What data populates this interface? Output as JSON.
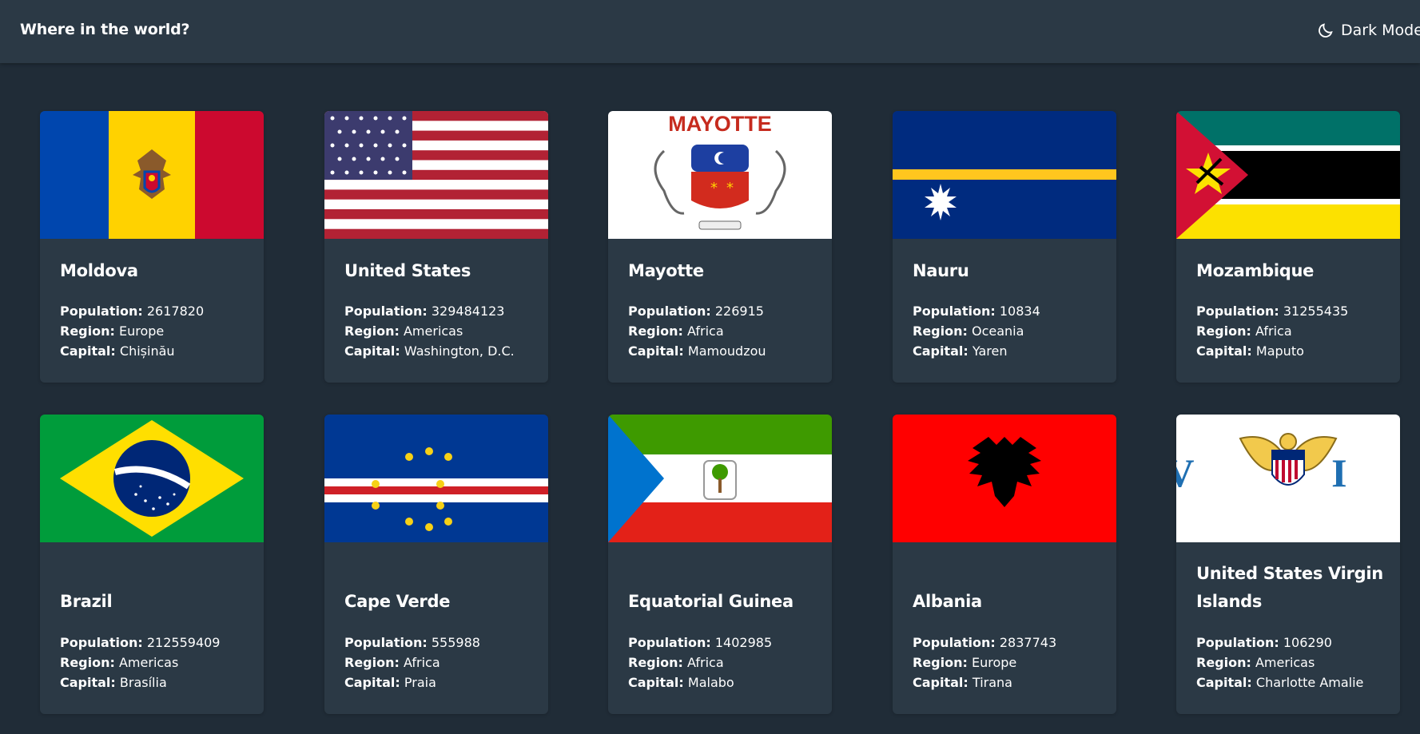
{
  "header": {
    "title": "Where in the world?",
    "mode_label": "Dark Mode",
    "mode_icon": "moon-icon"
  },
  "labels": {
    "population": "Population:",
    "region": "Region:",
    "capital": "Capital:"
  },
  "countries": [
    {
      "name": "Moldova",
      "population": "2617820",
      "region": "Europe",
      "capital": "Chișinău",
      "flag": "moldova-flag"
    },
    {
      "name": "United States",
      "population": "329484123",
      "region": "Americas",
      "capital": "Washington, D.C.",
      "flag": "united-states-flag"
    },
    {
      "name": "Mayotte",
      "population": "226915",
      "region": "Africa",
      "capital": "Mamoudzou",
      "flag": "mayotte-flag",
      "flag_text": "MAYOTTE"
    },
    {
      "name": "Nauru",
      "population": "10834",
      "region": "Oceania",
      "capital": "Yaren",
      "flag": "nauru-flag"
    },
    {
      "name": "Mozambique",
      "population": "31255435",
      "region": "Africa",
      "capital": "Maputo",
      "flag": "mozambique-flag"
    },
    {
      "name": "Brazil",
      "population": "212559409",
      "region": "Americas",
      "capital": "Brasília",
      "flag": "brazil-flag"
    },
    {
      "name": "Cape Verde",
      "population": "555988",
      "region": "Africa",
      "capital": "Praia",
      "flag": "cape-verde-flag"
    },
    {
      "name": "Equatorial Guinea",
      "population": "1402985",
      "region": "Africa",
      "capital": "Malabo",
      "flag": "equatorial-guinea-flag"
    },
    {
      "name": "Albania",
      "population": "2837743",
      "region": "Europe",
      "capital": "Tirana",
      "flag": "albania-flag"
    },
    {
      "name": "United States Virgin Islands",
      "population": "106290",
      "region": "Americas",
      "capital": "Charlotte Amalie",
      "flag": "us-virgin-islands-flag",
      "flag_text": "V I"
    }
  ],
  "colors": {
    "background": "#202c37",
    "surface": "#2b3945",
    "text": "#ffffff"
  }
}
